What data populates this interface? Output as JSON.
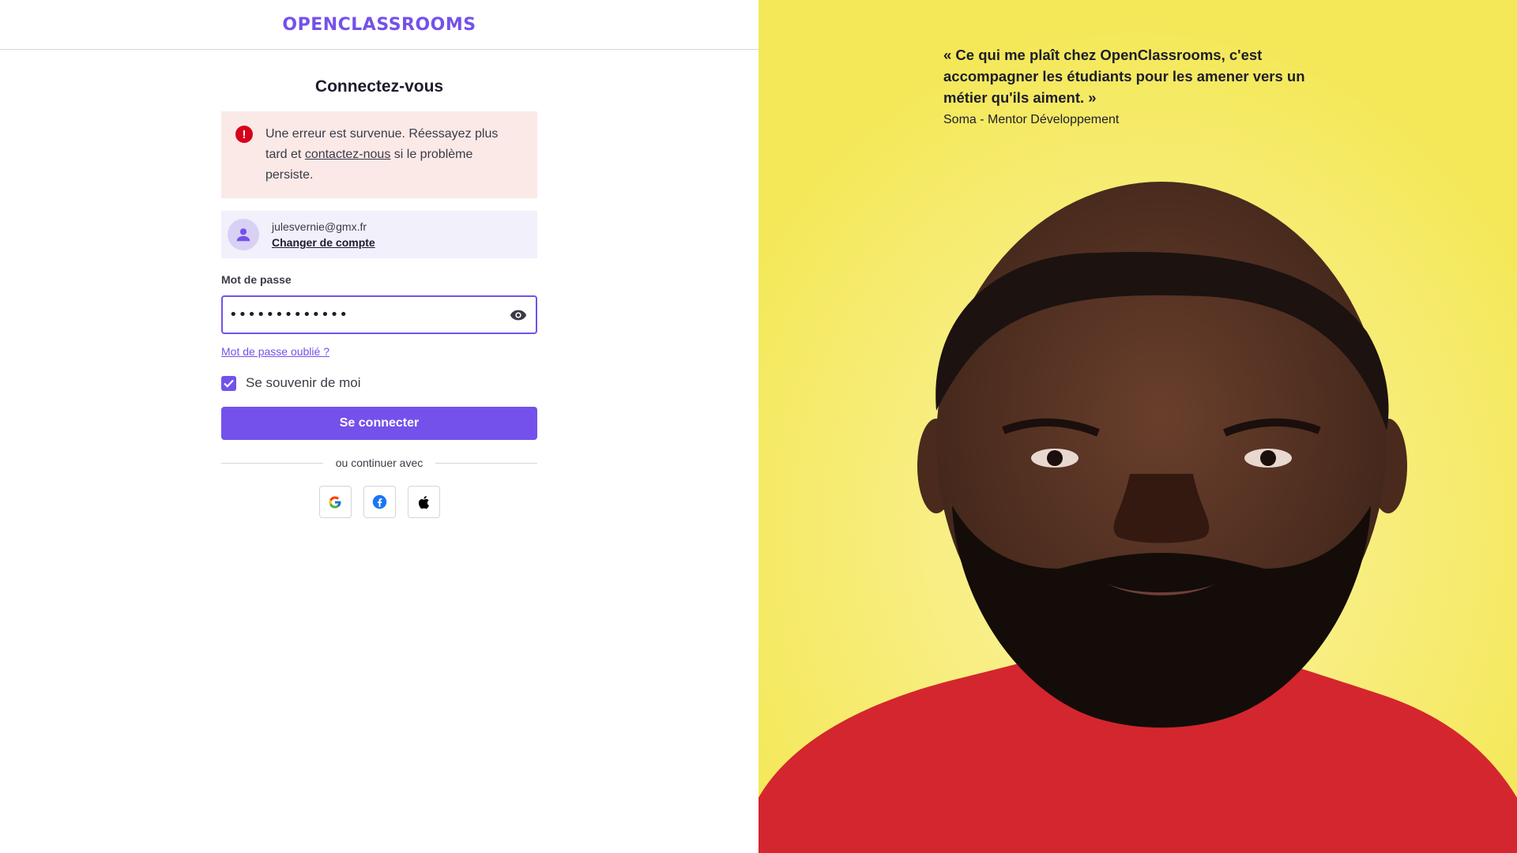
{
  "brand": {
    "logo_text": "OPENCLASSROOMS",
    "accent": "#7451eb"
  },
  "login": {
    "title": "Connectez-vous",
    "error": {
      "text_before": "Une erreur est survenue. Réessayez plus tard et ",
      "link": "contactez-nous",
      "text_after": " si le problème persiste."
    },
    "account": {
      "email": "julesvernie@gmx.fr",
      "change_label": "Changer de compte"
    },
    "password": {
      "label": "Mot de passe",
      "value": "•••••••••••••"
    },
    "forgot_label": "Mot de passe oublié ?",
    "remember_label": "Se souvenir de moi",
    "remember_checked": true,
    "submit_label": "Se connecter",
    "divider_label": "ou continuer avec",
    "social": [
      "google-icon",
      "facebook-icon",
      "apple-icon"
    ]
  },
  "testimonial": {
    "quote": "« Ce qui me plaît chez OpenClassrooms, c'est accompagner les étudiants pour les amener vers un métier qu'ils aiment. »",
    "author": "Soma - Mentor Développement",
    "background": "#f4e858"
  }
}
